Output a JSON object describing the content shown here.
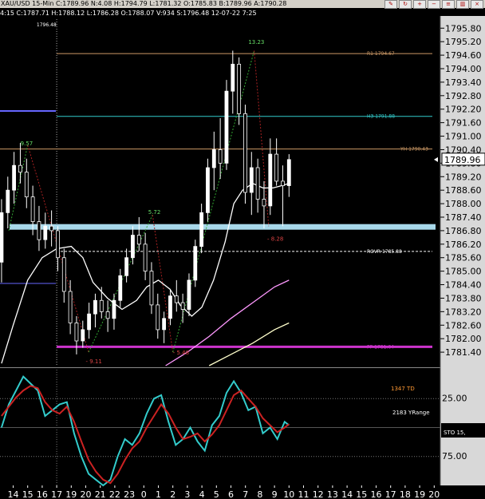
{
  "window": {
    "title": "XAU/USD 15-Min C:1789.96 N:4.08 H:1794.79 L:1781.32 O:1785.83 B:1789.96 A:1790.28",
    "info_line": "4:15 C:1787.71 H:1788.12 L:1786.28 O:1788.07 V:934 S:1796.48 12-07-22 7:25",
    "toolbar_icons": [
      "drawing-tool-icon",
      "refresh-icon",
      "zoom-in-icon",
      "zoom-out-icon",
      "properties-icon",
      "chart-style-icon",
      "close-icon"
    ]
  },
  "colors": {
    "background": "#000000",
    "up_candle": "#ffffff",
    "down_candle": "#ffffff",
    "stoch_k": "#33cccc",
    "stoch_d": "#cc2222",
    "pivot": "#cc33cc",
    "r1": "#cc9966",
    "h3": "#33cccc",
    "yh": "#cc9966",
    "rover": "#ffffff",
    "band": "#a8d8ea"
  },
  "chart_data": [
    {
      "type": "candlestick",
      "symbol": "XAU/USD",
      "timeframe": "15-Min",
      "ylim": [
        1780.8,
        1796.2
      ],
      "ylabels": [
        "1795.80",
        "1795.20",
        "1794.60",
        "1794.00",
        "1793.40",
        "1792.80",
        "1792.20",
        "1791.60",
        "1791.00",
        "1790.40",
        "1789.80",
        "1789.20",
        "1788.60",
        "1788.00",
        "1787.40",
        "1786.80",
        "1786.20",
        "1785.60",
        "1785.00",
        "1784.40",
        "1783.80",
        "1783.20",
        "1782.60",
        "1782.00",
        "1781.40"
      ],
      "yvalues": [
        1795.8,
        1795.2,
        1794.6,
        1794.0,
        1793.4,
        1792.8,
        1792.2,
        1791.6,
        1791.0,
        1790.4,
        1789.8,
        1789.2,
        1788.6,
        1788.0,
        1787.4,
        1786.8,
        1786.2,
        1785.6,
        1785.0,
        1784.4,
        1783.8,
        1783.2,
        1782.6,
        1782.0,
        1781.4
      ],
      "last_price": {
        "label": "1789.96",
        "value": 1789.96
      },
      "x_hours": [
        "14",
        "15",
        "16",
        "17",
        "19",
        "20",
        "21",
        "22",
        "23",
        "0",
        "1",
        "2",
        "3",
        "4",
        "5",
        "6",
        "7",
        "8",
        "9",
        "10",
        "11",
        "12",
        "13",
        "14",
        "15",
        "16",
        "17",
        "18",
        "19",
        "20"
      ],
      "hour_index": [
        0,
        1,
        2,
        3,
        4,
        5,
        6,
        7,
        8,
        9,
        10,
        11,
        12,
        13,
        14,
        15,
        16,
        17,
        18,
        19,
        20,
        21,
        22,
        23,
        24,
        25,
        26,
        27,
        28,
        29
      ],
      "levels": [
        {
          "name": "R1",
          "label": "R1 1794.67",
          "value": 1794.67,
          "color": "#cc9966",
          "start": 3.0
        },
        {
          "name": "H3",
          "label": "H3 1791.88",
          "value": 1791.88,
          "color": "#33cccc",
          "start": 3.0
        },
        {
          "name": "YH",
          "label": "YH 1790.43",
          "value": 1790.43,
          "color": "#cc9966",
          "start": -1
        },
        {
          "name": "ROVR",
          "label": "ROVR 1785.88",
          "value": 1785.88,
          "color": "#ffffff",
          "start": 3.0,
          "dashed": true
        },
        {
          "name": "PP",
          "label": "PP 1781.64",
          "value": 1781.64,
          "color": "#cc33cc",
          "start": 3.0,
          "thick": true
        }
      ],
      "band_value": 1786.95,
      "previous_high_label": "1796.48",
      "swing_labels": [
        {
          "text": "9.57",
          "x": 0.5,
          "y": 1790.6,
          "color": "#66dd66"
        },
        {
          "text": "5.72",
          "x": 9.3,
          "y": 1787.55,
          "color": "#66dd66"
        },
        {
          "text": "13.23",
          "x": 16.2,
          "y": 1795.1,
          "color": "#66dd66"
        },
        {
          "text": "- 9.11",
          "x": 5.0,
          "y": 1780.9,
          "color": "#dd4444"
        },
        {
          "text": "- 5.48",
          "x": 11.0,
          "y": 1781.3,
          "color": "#dd4444"
        },
        {
          "text": "- 8.28",
          "x": 17.5,
          "y": 1786.35,
          "color": "#dd4444"
        }
      ],
      "candles": [
        [
          1785.4,
          1788.2,
          1784.5,
          1787.6
        ],
        [
          1787.6,
          1789.2,
          1786.9,
          1788.6
        ],
        [
          1788.6,
          1790.3,
          1788.0,
          1789.7
        ],
        [
          1789.7,
          1790.7,
          1788.9,
          1789.4
        ],
        [
          1789.4,
          1790.0,
          1787.8,
          1788.3
        ],
        [
          1788.3,
          1788.8,
          1786.6,
          1787.2
        ],
        [
          1787.2,
          1787.9,
          1785.9,
          1786.4
        ],
        [
          1786.4,
          1787.6,
          1786.0,
          1787.0
        ],
        [
          1787.0,
          1787.7,
          1786.1,
          1786.8
        ],
        [
          1786.8,
          1787.0,
          1785.0,
          1785.6
        ],
        [
          1785.6,
          1786.0,
          1783.6,
          1784.1
        ],
        [
          1784.1,
          1784.6,
          1782.2,
          1782.7
        ],
        [
          1782.7,
          1783.0,
          1781.3,
          1781.9
        ],
        [
          1781.9,
          1782.8,
          1781.6,
          1782.4
        ],
        [
          1782.4,
          1783.6,
          1782.0,
          1783.1
        ],
        [
          1783.1,
          1784.0,
          1782.5,
          1783.7
        ],
        [
          1783.7,
          1784.3,
          1782.9,
          1783.2
        ],
        [
          1783.2,
          1783.7,
          1782.3,
          1782.9
        ],
        [
          1782.9,
          1784.0,
          1782.4,
          1783.7
        ],
        [
          1783.7,
          1785.1,
          1783.4,
          1784.8
        ],
        [
          1784.8,
          1786.0,
          1784.5,
          1785.6
        ],
        [
          1785.6,
          1787.0,
          1785.3,
          1786.6
        ],
        [
          1786.6,
          1787.4,
          1785.9,
          1786.2
        ],
        [
          1786.2,
          1786.7,
          1784.6,
          1785.0
        ],
        [
          1785.0,
          1785.4,
          1783.1,
          1783.5
        ],
        [
          1783.5,
          1784.0,
          1782.0,
          1782.4
        ],
        [
          1782.4,
          1783.2,
          1781.8,
          1782.9
        ],
        [
          1782.9,
          1784.2,
          1782.6,
          1783.9
        ],
        [
          1783.9,
          1784.6,
          1783.2,
          1783.6
        ],
        [
          1783.6,
          1784.0,
          1782.7,
          1783.3
        ],
        [
          1783.3,
          1784.9,
          1783.0,
          1784.6
        ],
        [
          1784.6,
          1786.4,
          1784.3,
          1786.1
        ],
        [
          1786.1,
          1788.0,
          1785.8,
          1787.6
        ],
        [
          1787.6,
          1790.0,
          1787.2,
          1789.6
        ],
        [
          1789.6,
          1791.2,
          1788.6,
          1790.4
        ],
        [
          1790.4,
          1791.8,
          1789.1,
          1789.8
        ],
        [
          1789.8,
          1793.5,
          1789.5,
          1793.0
        ],
        [
          1793.0,
          1794.8,
          1792.0,
          1794.2
        ],
        [
          1794.2,
          1794.5,
          1791.5,
          1792.0
        ],
        [
          1792.0,
          1792.4,
          1788.0,
          1788.5
        ],
        [
          1788.5,
          1790.3,
          1787.5,
          1789.6
        ],
        [
          1789.6,
          1790.0,
          1787.6,
          1788.2
        ],
        [
          1788.2,
          1789.0,
          1786.9,
          1787.9
        ],
        [
          1787.9,
          1790.9,
          1787.5,
          1790.2
        ],
        [
          1790.2,
          1790.9,
          1788.8,
          1789.0
        ],
        [
          1789.0,
          1789.7,
          1787.0,
          1788.8
        ],
        [
          1788.8,
          1790.2,
          1788.3,
          1789.96
        ]
      ],
      "moving_averages": [
        {
          "name": "fast",
          "color": "#ffffff",
          "values": [
            [
              -0.8,
              1780.9
            ],
            [
              0.0,
              1782.6
            ],
            [
              1.0,
              1784.6
            ],
            [
              2.0,
              1785.6
            ],
            [
              3.0,
              1786.0
            ],
            [
              4.0,
              1786.1
            ],
            [
              4.8,
              1785.6
            ],
            [
              5.5,
              1784.5
            ],
            [
              6.5,
              1783.8
            ],
            [
              7.5,
              1783.3
            ],
            [
              8.5,
              1783.7
            ],
            [
              9.2,
              1784.3
            ],
            [
              10.0,
              1784.6
            ],
            [
              10.8,
              1784.2
            ],
            [
              11.5,
              1783.5
            ],
            [
              12.3,
              1783.0
            ],
            [
              13.0,
              1783.4
            ],
            [
              13.8,
              1784.6
            ],
            [
              14.6,
              1786.3
            ],
            [
              15.2,
              1788.0
            ],
            [
              15.8,
              1788.6
            ],
            [
              16.5,
              1788.9
            ],
            [
              17.2,
              1788.7
            ],
            [
              17.9,
              1788.7
            ],
            [
              18.5,
              1788.8
            ],
            [
              19.0,
              1788.9
            ]
          ]
        },
        {
          "name": "medium",
          "color": "#ff99ff",
          "values": [
            [
              10.5,
              1780.8
            ],
            [
              12.0,
              1781.4
            ],
            [
              13.5,
              1782.1
            ],
            [
              15.0,
              1782.9
            ],
            [
              16.5,
              1783.6
            ],
            [
              18.0,
              1784.3
            ],
            [
              19.0,
              1784.6
            ]
          ]
        },
        {
          "name": "slow",
          "color": "#ffffcc",
          "values": [
            [
              13.5,
              1780.8
            ],
            [
              15.0,
              1781.3
            ],
            [
              16.5,
              1781.8
            ],
            [
              18.0,
              1782.4
            ],
            [
              19.0,
              1782.7
            ]
          ]
        }
      ]
    },
    {
      "type": "line",
      "name": "Stochastic",
      "label": "STO  15,",
      "ylim": [
        0,
        100
      ],
      "yreversed": true,
      "ylabels": [
        "25.00",
        "75.00"
      ],
      "yvalues": [
        25,
        75
      ],
      "side_text": [
        {
          "text": "1347 TD",
          "color": "#ff9933"
        },
        {
          "text": "2183 YRange",
          "color": "#ffffff"
        }
      ],
      "x": [
        -0.8,
        -0.3,
        0.2,
        0.7,
        1.2,
        1.7,
        2.2,
        2.7,
        3.2,
        3.7,
        4.2,
        4.7,
        5.2,
        5.7,
        6.2,
        6.7,
        7.2,
        7.7,
        8.2,
        8.7,
        9.2,
        9.7,
        10.2,
        10.7,
        11.2,
        11.7,
        12.2,
        12.7,
        13.2,
        13.7,
        14.2,
        14.7,
        15.2,
        15.7,
        16.2,
        16.7,
        17.2,
        17.7,
        18.2,
        18.7,
        19.0
      ],
      "series": [
        {
          "name": "%K",
          "color": "#33cccc",
          "values": [
            50,
            30,
            18,
            6,
            12,
            18,
            40,
            35,
            30,
            28,
            55,
            75,
            90,
            95,
            100,
            95,
            75,
            60,
            65,
            55,
            38,
            25,
            22,
            45,
            65,
            60,
            50,
            62,
            70,
            48,
            40,
            20,
            10,
            20,
            35,
            32,
            55,
            50,
            60,
            45,
            48
          ]
        },
        {
          "name": "%D",
          "color": "#cc2222",
          "values": [
            40,
            32,
            24,
            18,
            14,
            16,
            28,
            35,
            38,
            32,
            45,
            62,
            78,
            88,
            95,
            98,
            90,
            78,
            68,
            62,
            50,
            40,
            30,
            38,
            50,
            60,
            58,
            55,
            62,
            56,
            48,
            35,
            22,
            18,
            25,
            32,
            42,
            48,
            54,
            50,
            47
          ]
        }
      ]
    }
  ]
}
